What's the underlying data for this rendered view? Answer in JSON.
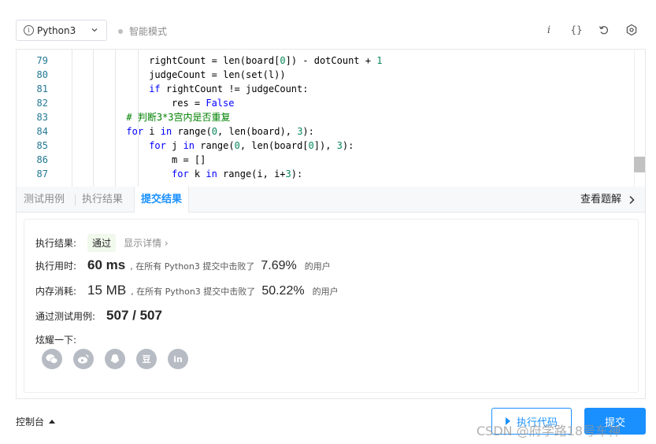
{
  "toolbar": {
    "language": "Python3",
    "mode_label": "智能模式",
    "icons": [
      "info-icon",
      "braces-icon",
      "reset-icon",
      "settings-icon"
    ],
    "info_glyph": "i",
    "braces_glyph": "{}"
  },
  "editor": {
    "lines": [
      {
        "no": "79",
        "indent": 4,
        "tokens": [
          {
            "t": "rightCount = len(board[",
            "c": "tok"
          },
          {
            "t": "0",
            "c": "num"
          },
          {
            "t": "]) - dotCount + ",
            "c": "tok"
          },
          {
            "t": "1",
            "c": "num"
          }
        ]
      },
      {
        "no": "80",
        "indent": 4,
        "tokens": [
          {
            "t": "judgeCount = len(set(l))",
            "c": "tok"
          }
        ]
      },
      {
        "no": "81",
        "indent": 4,
        "tokens": [
          {
            "t": "if",
            "c": "kw"
          },
          {
            "t": " rightCount != judgeCount:",
            "c": "tok"
          }
        ]
      },
      {
        "no": "82",
        "indent": 5,
        "tokens": [
          {
            "t": "res = ",
            "c": "tok"
          },
          {
            "t": "False",
            "c": "kw"
          }
        ]
      },
      {
        "no": "83",
        "indent": 3,
        "tokens": [
          {
            "t": "# 判断3*3宫内是否重复",
            "c": "cmt"
          }
        ]
      },
      {
        "no": "84",
        "indent": 3,
        "tokens": [
          {
            "t": "for",
            "c": "kw"
          },
          {
            "t": " i ",
            "c": "tok"
          },
          {
            "t": "in",
            "c": "kw"
          },
          {
            "t": " range(",
            "c": "tok"
          },
          {
            "t": "0",
            "c": "num"
          },
          {
            "t": ", len(board), ",
            "c": "tok"
          },
          {
            "t": "3",
            "c": "num"
          },
          {
            "t": "):",
            "c": "tok"
          }
        ]
      },
      {
        "no": "85",
        "indent": 4,
        "tokens": [
          {
            "t": "for",
            "c": "kw"
          },
          {
            "t": " j ",
            "c": "tok"
          },
          {
            "t": "in",
            "c": "kw"
          },
          {
            "t": " range(",
            "c": "tok"
          },
          {
            "t": "0",
            "c": "num"
          },
          {
            "t": ", len(board[",
            "c": "tok"
          },
          {
            "t": "0",
            "c": "num"
          },
          {
            "t": "]), ",
            "c": "tok"
          },
          {
            "t": "3",
            "c": "num"
          },
          {
            "t": "):",
            "c": "tok"
          }
        ]
      },
      {
        "no": "86",
        "indent": 5,
        "tokens": [
          {
            "t": "m = []",
            "c": "tok"
          }
        ]
      },
      {
        "no": "87",
        "indent": 5,
        "tokens": [
          {
            "t": "for",
            "c": "kw"
          },
          {
            "t": " k ",
            "c": "tok"
          },
          {
            "t": "in",
            "c": "kw"
          },
          {
            "t": " range(i, i+",
            "c": "tok"
          },
          {
            "t": "3",
            "c": "num"
          },
          {
            "t": "):",
            "c": "tok"
          }
        ]
      }
    ]
  },
  "tabs": {
    "test_case": "测试用例",
    "run_result": "执行结果",
    "submit_result": "提交结果",
    "view_solution": "查看题解"
  },
  "result": {
    "status_label": "执行结果:",
    "status_value": "通过",
    "details_link": "显示详情",
    "time_label": "执行用时:",
    "time_value": "60 ms",
    "time_mid": ", 在所有 Python3 提交中击败了",
    "time_percent": "7.69%",
    "time_suffix": "的用户",
    "mem_label": "内存消耗:",
    "mem_value": "15 MB",
    "mem_mid": ", 在所有 Python3 提交中击败了",
    "mem_percent": "50.22%",
    "mem_suffix": "的用户",
    "cases_label": "通过测试用例:",
    "cases_value": "507 / 507",
    "share_label": "炫耀一下:",
    "share_icons": [
      "wechat-icon",
      "weibo-icon",
      "qq-icon",
      "douban-icon",
      "linkedin-icon"
    ],
    "douban_glyph": "豆",
    "linkedin_glyph": "in"
  },
  "footer": {
    "console_label": "控制台",
    "run_code": "执行代码",
    "submit": "提交",
    "watermark": "CSDN @府学路18号车神"
  }
}
